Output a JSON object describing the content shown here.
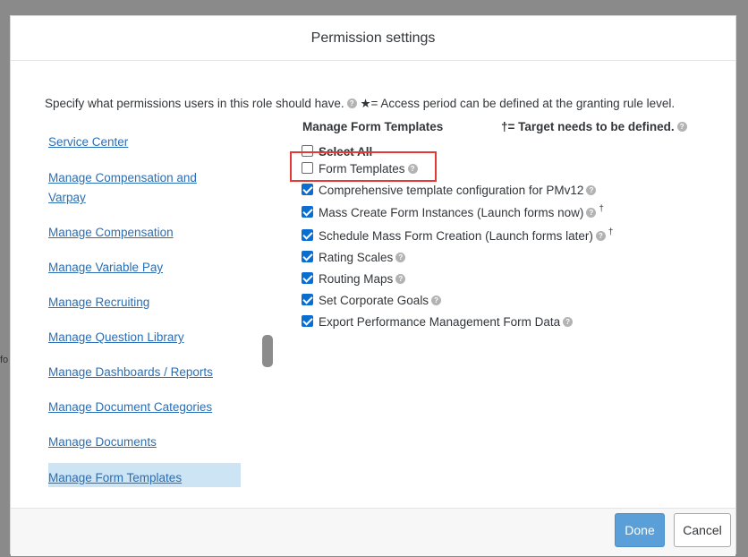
{
  "dialog": {
    "title": "Permission settings",
    "intro_text": "Specify what permissions users in this role should have.",
    "intro_note": "★= Access period can be defined at the granting rule level."
  },
  "nav": {
    "items": [
      {
        "label": "Service Center"
      },
      {
        "label": "Manage Compensation and Varpay"
      },
      {
        "label": "Manage Compensation"
      },
      {
        "label": "Manage Variable Pay"
      },
      {
        "label": "Manage Recruiting"
      },
      {
        "label": "Manage Question Library"
      },
      {
        "label": "Manage Dashboards / Reports"
      },
      {
        "label": "Manage Document Categories"
      },
      {
        "label": "Manage Documents"
      },
      {
        "label": "Manage Form Templates",
        "selected": true
      }
    ]
  },
  "permissions": {
    "section_title": "Manage Form Templates",
    "target_note": "†= Target needs to be defined.",
    "dagger": "†",
    "items": [
      {
        "label": "Select All",
        "checked": false
      },
      {
        "label": "Form Templates",
        "checked": false,
        "highlighted": true
      },
      {
        "label": "Comprehensive template configuration for PMv12",
        "checked": true
      },
      {
        "label": "Mass Create Form Instances (Launch forms now)",
        "checked": true,
        "target": true
      },
      {
        "label": "Schedule Mass Form Creation (Launch forms later)",
        "checked": true,
        "target": true
      },
      {
        "label": "Rating Scales",
        "checked": true
      },
      {
        "label": "Routing Maps",
        "checked": true
      },
      {
        "label": "Set Corporate Goals",
        "checked": true
      },
      {
        "label": "Export Performance Management Form Data",
        "checked": true
      }
    ]
  },
  "footer": {
    "done_label": "Done",
    "cancel_label": "Cancel"
  },
  "background": {
    "left_text": "fo"
  },
  "colors": {
    "accent": "#0a6ed1",
    "link": "#2a6eb5",
    "selected_bg": "#cce4f4",
    "highlight_box": "#e53935"
  }
}
